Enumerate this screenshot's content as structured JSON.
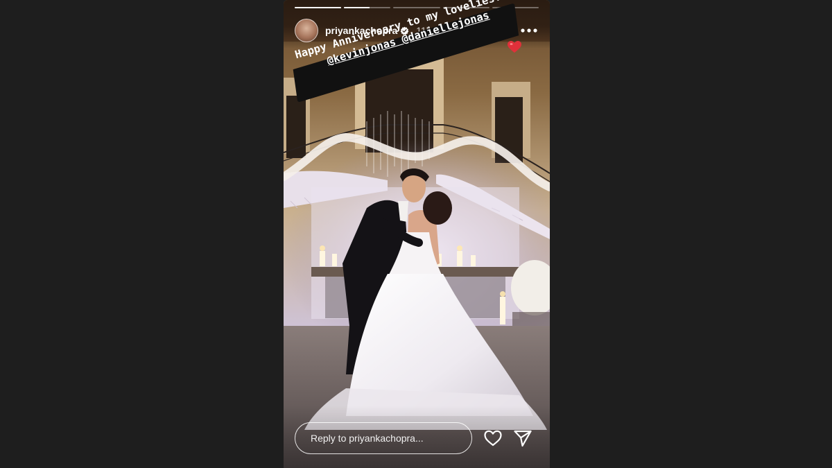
{
  "story": {
    "user": {
      "username": "priyankachopra",
      "verified": true,
      "timestamp": "11h",
      "avatar": "profile-avatar"
    },
    "progress": [
      1,
      0.55,
      0,
      0,
      0
    ],
    "caption": {
      "line1": "Happy Anniversary to my lovelies!!",
      "line2": "@kevinjonas @daniellejonas",
      "emoji": "red-heart"
    },
    "controls": {
      "pause_icon": "pause-icon",
      "mute_icon": "muted-speaker-icon",
      "more_icon": "more-options-icon"
    },
    "reply": {
      "placeholder": "Reply to priyankachopra..."
    },
    "actions": {
      "like_icon": "heart-icon",
      "share_icon": "send-icon"
    }
  },
  "colors": {
    "page_background": "#1e1e1e",
    "caption_band": "#111111",
    "heart": "#e0303a",
    "verified_badge": "#ffffff"
  }
}
